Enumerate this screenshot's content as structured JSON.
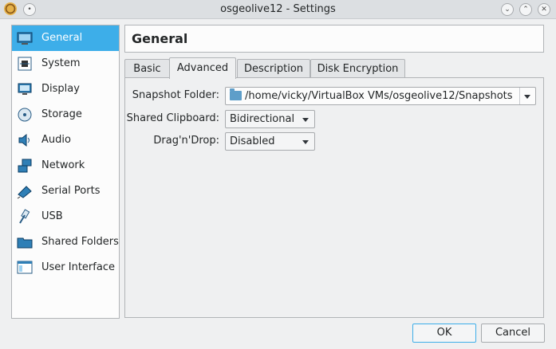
{
  "window": {
    "title": "osgeolive12 - Settings"
  },
  "sidebar": {
    "items": [
      {
        "label": "General",
        "icon": "general-icon",
        "selected": true
      },
      {
        "label": "System",
        "icon": "system-icon"
      },
      {
        "label": "Display",
        "icon": "display-icon"
      },
      {
        "label": "Storage",
        "icon": "storage-icon"
      },
      {
        "label": "Audio",
        "icon": "audio-icon"
      },
      {
        "label": "Network",
        "icon": "network-icon"
      },
      {
        "label": "Serial Ports",
        "icon": "serial-ports-icon"
      },
      {
        "label": "USB",
        "icon": "usb-icon"
      },
      {
        "label": "Shared Folders",
        "icon": "shared-folders-icon"
      },
      {
        "label": "User Interface",
        "icon": "user-interface-icon"
      }
    ]
  },
  "header": {
    "title": "General"
  },
  "tabs": [
    {
      "label": "Basic"
    },
    {
      "label": "Advanced",
      "active": true
    },
    {
      "label": "Description"
    },
    {
      "label": "Disk Encryption"
    }
  ],
  "advanced": {
    "snapshot_folder_label": "Snapshot Folder:",
    "snapshot_folder_value": "/home/vicky/VirtualBox VMs/osgeolive12/Snapshots",
    "shared_clipboard_label": "Shared Clipboard:",
    "shared_clipboard_value": "Bidirectional",
    "dragndrop_label": "Drag'n'Drop:",
    "dragndrop_value": "Disabled"
  },
  "buttons": {
    "ok": "OK",
    "cancel": "Cancel"
  },
  "colors": {
    "accent": "#3daee9",
    "window_bg": "#eff0f1",
    "titlebar_bg": "#dcdfe2"
  }
}
